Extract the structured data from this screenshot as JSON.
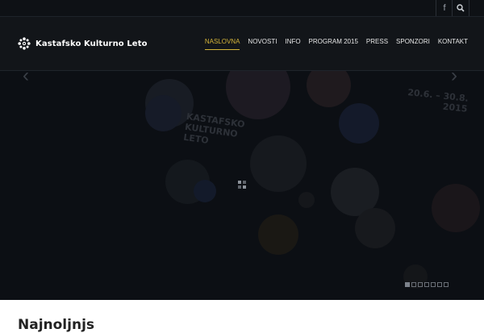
{
  "topbar": {
    "icons": [
      "facebook-icon",
      "search-icon"
    ]
  },
  "header": {
    "logo_text": "Kastafsko Kulturno Leto",
    "nav": [
      "NASLOVNA",
      "NOVOSTI",
      "INFO",
      "PROGRAM 2015",
      "PRESS",
      "SPONZORI",
      "KONTAKT"
    ]
  },
  "slider": {
    "poster_title": [
      "KASTAFSKO",
      "KULTURNO",
      "LETO"
    ],
    "poster_date": [
      "20.6. – 30.8.",
      "2015"
    ],
    "slide_count": 7,
    "active_slide": 1
  },
  "content": {
    "title": "Najnoljnjs"
  },
  "colors": {
    "accent": "#d4b43a",
    "header_bg": "#121519",
    "slider_bg": "#0c0f14"
  }
}
